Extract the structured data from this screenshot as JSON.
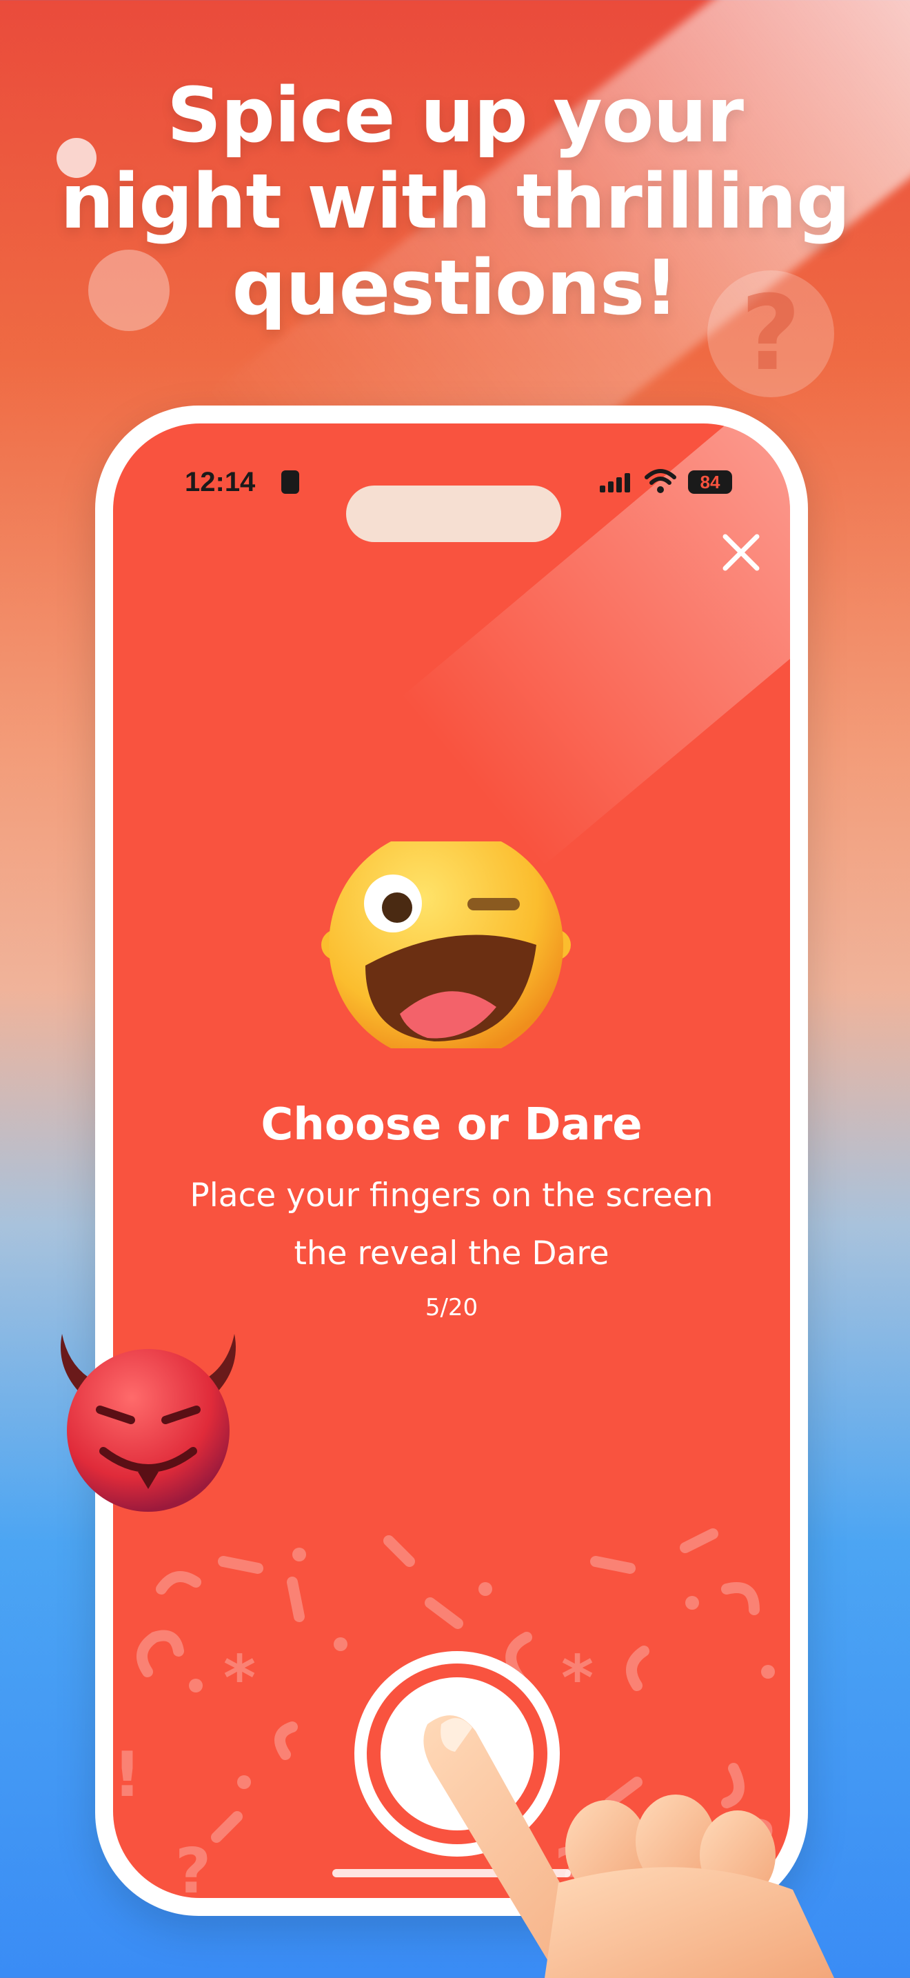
{
  "headline": {
    "line1": "Spice up your",
    "line2": "night with thrilling",
    "line3": "questions!"
  },
  "decoration": {
    "question_mark": "?"
  },
  "status_bar": {
    "time": "12:14",
    "battery": "84"
  },
  "screen": {
    "title": "Choose or Dare",
    "subtitle_line1": "Place your fingers on the screen",
    "subtitle_line2": "the reveal the Dare",
    "counter": "5/20"
  },
  "icons": {
    "close": "close-icon",
    "emoji_top": "winking-face-emoji",
    "emoji_devil": "smiling-devil-emoji",
    "hand": "pointing-finger"
  },
  "colors": {
    "screen_background": "#f9533f",
    "frame": "#ffffff",
    "text": "#ffffff"
  }
}
